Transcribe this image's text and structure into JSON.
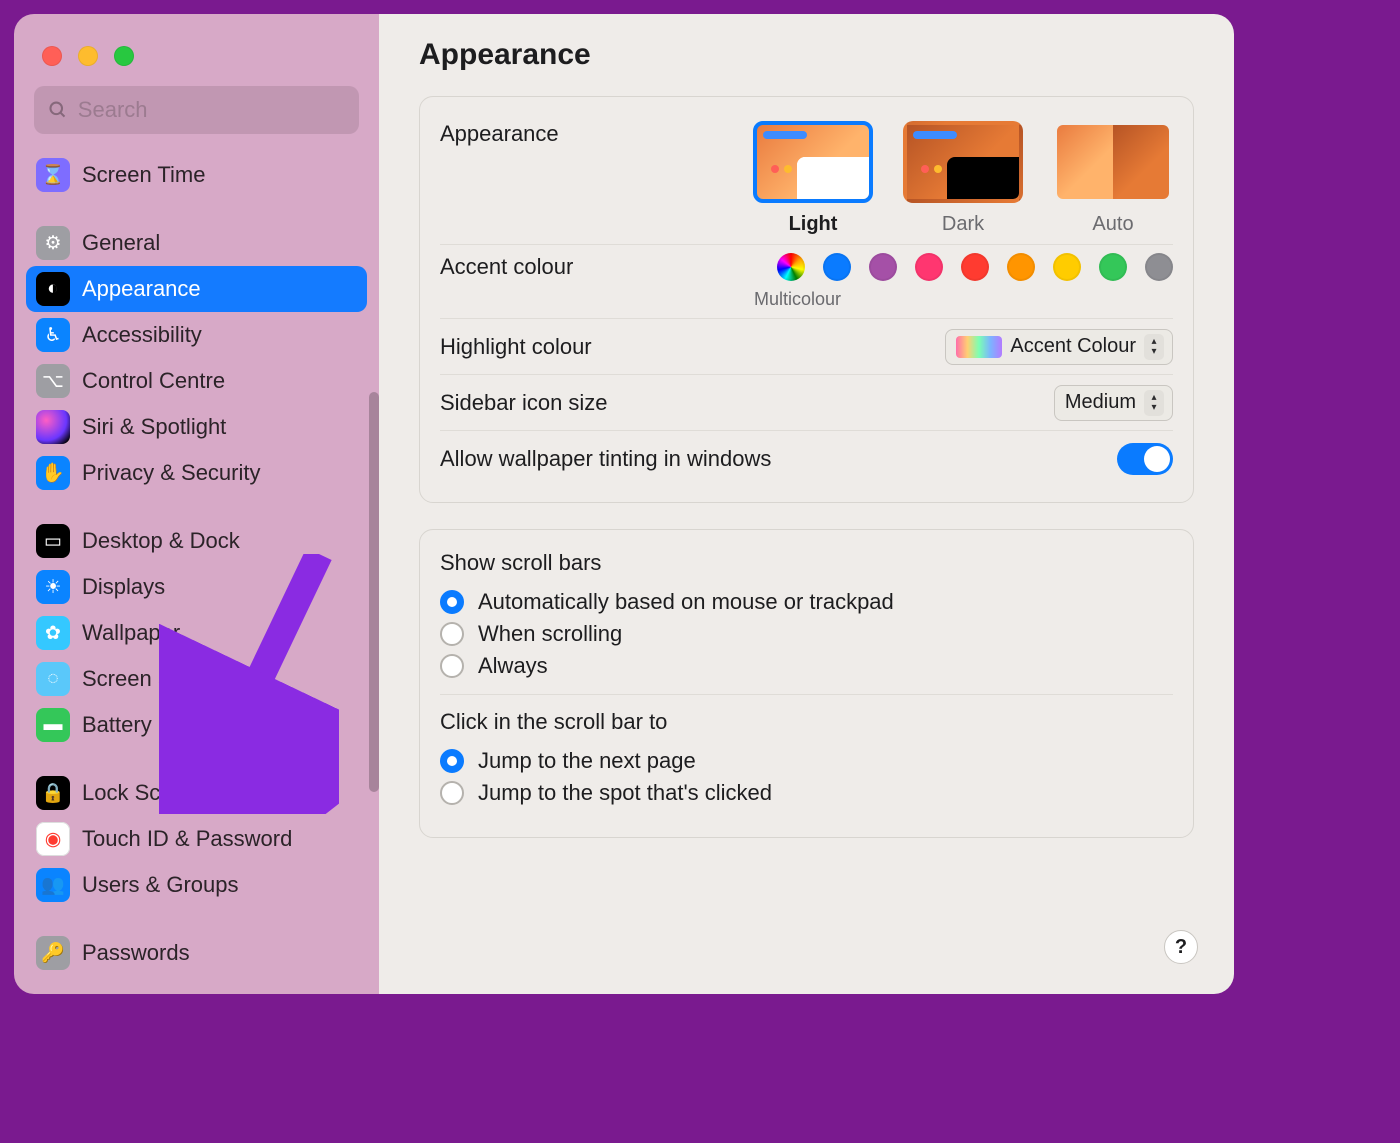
{
  "window": {
    "search_placeholder": "Search",
    "title": "Appearance",
    "help_label": "?"
  },
  "sidebar": {
    "items": [
      {
        "key": "screen-time",
        "label": "Screen Time",
        "icon": "ic-screen-time",
        "glyph": "⌛"
      },
      {
        "key": "gap1",
        "gap": true
      },
      {
        "key": "general",
        "label": "General",
        "icon": "ic-general",
        "glyph": "⚙"
      },
      {
        "key": "appearance",
        "label": "Appearance",
        "icon": "ic-appearance",
        "glyph": "◐",
        "selected": true
      },
      {
        "key": "accessibility",
        "label": "Accessibility",
        "icon": "ic-accessibility",
        "glyph": "♿︎"
      },
      {
        "key": "control-centre",
        "label": "Control Centre",
        "icon": "ic-control",
        "glyph": "⌥"
      },
      {
        "key": "siri",
        "label": "Siri & Spotlight",
        "icon": "ic-siri",
        "glyph": ""
      },
      {
        "key": "privacy",
        "label": "Privacy & Security",
        "icon": "ic-privacy",
        "glyph": "✋"
      },
      {
        "key": "gap2",
        "gap": true
      },
      {
        "key": "desktop-dock",
        "label": "Desktop & Dock",
        "icon": "ic-desktop",
        "glyph": "▭"
      },
      {
        "key": "displays",
        "label": "Displays",
        "icon": "ic-displays",
        "glyph": "☀"
      },
      {
        "key": "wallpaper",
        "label": "Wallpaper",
        "icon": "ic-wallpaper",
        "glyph": "✿"
      },
      {
        "key": "screen-saver",
        "label": "Screen Saver",
        "icon": "ic-screensaver",
        "glyph": "◌"
      },
      {
        "key": "battery",
        "label": "Battery",
        "icon": "ic-battery",
        "glyph": "▬"
      },
      {
        "key": "gap3",
        "gap": true
      },
      {
        "key": "lock-screen",
        "label": "Lock Screen",
        "icon": "ic-lockscreen",
        "glyph": "🔒"
      },
      {
        "key": "touch-id",
        "label": "Touch ID & Password",
        "icon": "ic-touchid",
        "glyph": "◉"
      },
      {
        "key": "users-groups",
        "label": "Users & Groups",
        "icon": "ic-users",
        "glyph": "👥"
      },
      {
        "key": "gap4",
        "gap": true
      },
      {
        "key": "passwords",
        "label": "Passwords",
        "icon": "ic-passwords",
        "glyph": "🔑"
      }
    ]
  },
  "content": {
    "appearance": {
      "row_label": "Appearance",
      "options": [
        {
          "key": "light",
          "label": "Light",
          "selected": true
        },
        {
          "key": "dark",
          "label": "Dark",
          "selected": false
        },
        {
          "key": "auto",
          "label": "Auto",
          "selected": false
        }
      ]
    },
    "accent": {
      "row_label": "Accent colour",
      "caption": "Multicolour",
      "colours": [
        "conic-gradient(red,orange,yellow,green,cyan,blue,magenta,red)",
        "#0a7bff",
        "#a550a7",
        "#ff3670",
        "#ff3b30",
        "#ff9500",
        "#ffcc00",
        "#34c759",
        "#8e8e93"
      ]
    },
    "highlight": {
      "row_label": "Highlight colour",
      "value": "Accent Colour"
    },
    "sidebar_icon_size": {
      "row_label": "Sidebar icon size",
      "value": "Medium"
    },
    "tinting": {
      "row_label": "Allow wallpaper tinting in windows",
      "enabled": true
    },
    "scrollbars": {
      "title": "Show scroll bars",
      "options": [
        {
          "label": "Automatically based on mouse or trackpad",
          "checked": true
        },
        {
          "label": "When scrolling",
          "checked": false
        },
        {
          "label": "Always",
          "checked": false
        }
      ]
    },
    "click_scrollbar": {
      "title": "Click in the scroll bar to",
      "options": [
        {
          "label": "Jump to the next page",
          "checked": true
        },
        {
          "label": "Jump to the spot that's clicked",
          "checked": false
        }
      ]
    }
  }
}
